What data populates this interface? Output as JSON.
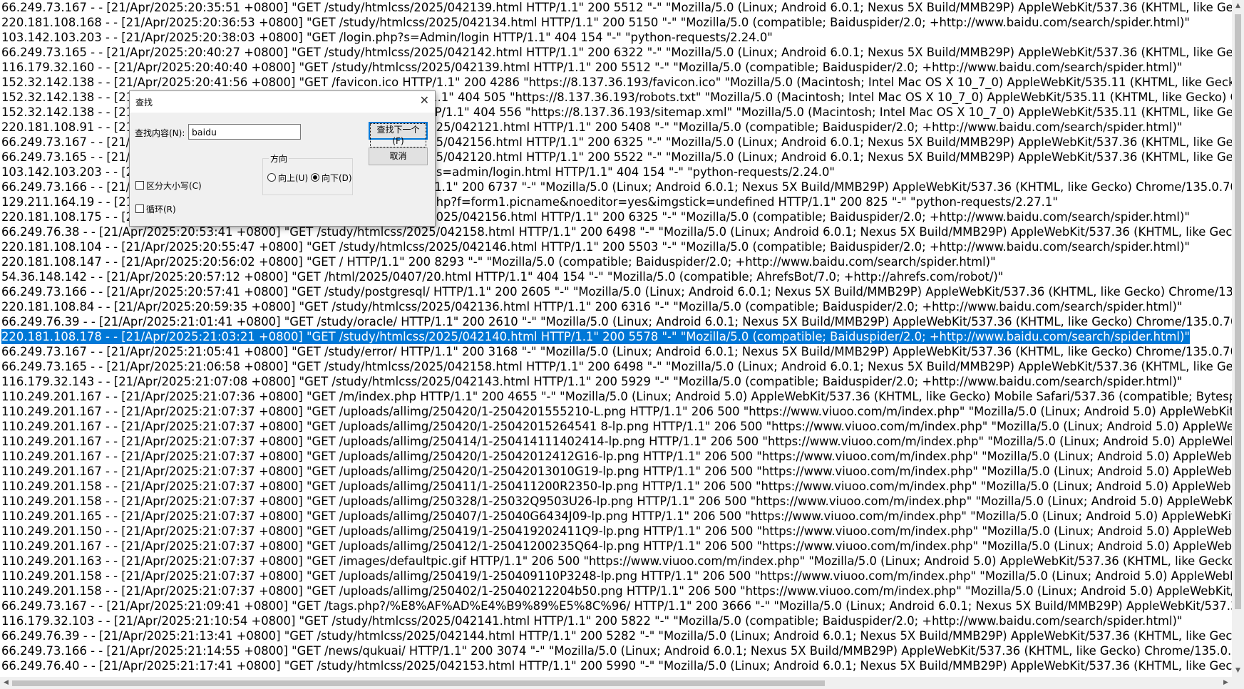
{
  "log_lines": [
    "66.249.73.167 - - [21/Apr/2025:20:35:51 +0800] \"GET /study/htmlcss/2025/042139.html HTTP/1.1\" 200 5512 \"-\" \"Mozilla/5.0 (Linux; Android 6.0.1; Nexus 5X Build/MMB29P) AppleWebKit/537.36 (KHTML, like Gecko) Chrome/135.0",
    "220.181.108.168 - - [21/Apr/2025:20:36:53 +0800] \"GET /study/htmlcss/2025/042134.html HTTP/1.1\" 200 5150 \"-\" \"Mozilla/5.0 (compatible; Baiduspider/2.0; +http://www.baidu.com/search/spider.html)\"",
    "103.142.103.203 - - [21/Apr/2025:20:38:03 +0800] \"GET /login.php?s=Admin/login HTTP/1.1\" 404 154 \"-\" \"python-requests/2.24.0\"",
    "66.249.73.165 - - [21/Apr/2025:20:40:27 +0800] \"GET /study/htmlcss/2025/042142.html HTTP/1.1\" 200 6322 \"-\" \"Mozilla/5.0 (Linux; Android 6.0.1; Nexus 5X Build/MMB29P) AppleWebKit/537.36 (KHTML, like Gecko) Chrome/135.0",
    "116.179.32.160 - - [21/Apr/2025:20:40:40 +0800] \"GET /study/htmlcss/2025/042139.html HTTP/1.1\" 200 5512 \"-\" \"Mozilla/5.0 (compatible; Baiduspider/2.0; +http://www.baidu.com/search/spider.html)\"",
    "152.32.142.138 - - [21/Apr/2025:20:41:56 +0800] \"GET /favicon.ico HTTP/1.1\" 200 4286 \"https://8.137.36.193/favicon.ico\" \"Mozilla/5.0 (Macintosh; Intel Mac OS X 10_7_0) AppleWebKit/535.11 (KHTML, like Gecko) Chrome/17.0.96",
    "152.32.142.138 - - [21/Apr/2025:20:41:56 +0800] \"GET /robots.txt HTTP/1.1\" 404 505 \"https://8.137.36.193/robots.txt\" \"Mozilla/5.0 (Macintosh; Intel Mac OS X 10_7_0) AppleWebKit/535.11 (KHTML, like Gecko) Chrome/17.0.963.56",
    "152.32.142.138 - - [21/Apr/2025:20:41:57 +0800] \"GET /sitemap.xml HTTP/1.1\" 404 556 \"https://8.137.36.193/sitemap.xml\" \"Mozilla/5.0 (Macintosh; Intel Mac OS X 10_7_0) AppleWebKit/535.11 (KHTML, like Gecko) Chrome/17.0.9",
    "220.181.108.91 - - [21/Apr/2025:20:43:06 +0800] \"GET /study/htmlcss/2025/042121.html HTTP/1.1\" 200 5408 \"-\" \"Mozilla/5.0 (compatible; Baiduspider/2.0; +http://www.baidu.com/search/spider.html)\"",
    "66.249.73.167 - - [21/Apr/2025:20:45:12 +0800] \"GET /study/htmlcss/2025/042156.html HTTP/1.1\" 200 6325 \"-\" \"Mozilla/5.0 (Linux; Android 6.0.1; Nexus 5X Build/MMB29P) AppleWebKit/537.36 (KHTML, like Gecko) Chrome/135.0",
    "66.249.73.165 - - [21/Apr/2025:20:46:30 +0800] \"GET /study/htmlcss/2025/042120.html HTTP/1.1\" 200 5522 \"-\" \"Mozilla/5.0 (Linux; Android 6.0.1; Nexus 5X Build/MMB29P) AppleWebKit/537.36 (KHTML, like Gecko) Chrome/135.0",
    "103.142.103.203 - - [21/Apr/2025:20:47:18 +0800] \"GET /login/login.php?s=admin/login.html HTTP/1.1\" 404 154 \"-\" \"python-requests/2.24.0\"",
    "66.249.73.166 - - [21/Apr/2025:20:48:02 +0800] \"GET /study/linux/ HTTP/1.1\" 200 6737 \"-\" \"Mozilla/5.0 (Linux; Android 6.0.1; Nexus 5X Build/MMB29P) AppleWebKit/537.36 (KHTML, like Gecko) Chrome/135.0.7049.95 Mobile S",
    "129.211.164.19 - - [21/Apr/2025:20:49:33 +0800] \"GET /tags.php?/ages.php?f=form1.picname&noeditor=yes&imgstick=undefined HTTP/1.1\" 200 825 \"-\" \"python-requests/2.27.1\"",
    "220.181.108.175 - - [21/Apr/2025:20:51:10 +0800] \"GET /study/htmlcss/2025/042156.html HTTP/1.1\" 200 6325 \"-\" \"Mozilla/5.0 (compatible; Baiduspider/2.0; +http://www.baidu.com/search/spider.html)\"",
    "66.249.76.38 - - [21/Apr/2025:20:53:41 +0800] \"GET /study/htmlcss/2025/042158.html HTTP/1.1\" 200 6498 \"-\" \"Mozilla/5.0 (Linux; Android 6.0.1; Nexus 5X Build/MMB29P) AppleWebKit/537.36 (KHTML, like Gecko) Chrome/135.0.",
    "220.181.108.104 - - [21/Apr/2025:20:55:47 +0800] \"GET /study/htmlcss/2025/042146.html HTTP/1.1\" 200 5503 \"-\" \"Mozilla/5.0 (compatible; Baiduspider/2.0; +http://www.baidu.com/search/spider.html)\"",
    "220.181.108.147 - - [21/Apr/2025:20:56:02 +0800] \"GET / HTTP/1.1\" 200 8293 \"-\" \"Mozilla/5.0 (compatible; Baiduspider/2.0; +http://www.baidu.com/search/spider.html)\"",
    "54.36.148.142 - - [21/Apr/2025:20:57:12 +0800] \"GET /html/2025/0407/20.html HTTP/1.1\" 404 154 \"-\" \"Mozilla/5.0 (compatible; AhrefsBot/7.0; +http://ahrefs.com/robot/)\"",
    "66.249.73.166 - - [21/Apr/2025:20:57:41 +0800] \"GET /study/postgresql/ HTTP/1.1\" 200 2605 \"-\" \"Mozilla/5.0 (Linux; Android 6.0.1; Nexus 5X Build/MMB29P) AppleWebKit/537.36 (KHTML, like Gecko) Chrome/135.0.7049.95 Mobile Sa",
    "220.181.108.84 - - [21/Apr/2025:20:59:35 +0800] \"GET /study/htmlcss/2025/042136.html HTTP/1.1\" 200 6316 \"-\" \"Mozilla/5.0 (compatible; Baiduspider/2.0; +http://www.baidu.com/search/spider.html)\"",
    "66.249.76.39 - - [21/Apr/2025:21:01:41 +0800] \"GET /study/oracle/ HTTP/1.1\" 200 2610 \"-\" \"Mozilla/5.0 (Linux; Android 6.0.1; Nexus 5X Build/MMB29P) AppleWebKit/537.36 (KHTML, like Gecko) Chrome/135.0.7049.95 Mobile Safa",
    "220.181.108.178 - - [21/Apr/2025:21:03:21 +0800] \"GET /study/htmlcss/2025/042140.html HTTP/1.1\" 200 5578 \"-\" \"Mozilla/5.0 (compatible; Baiduspider/2.0; +http://www.baidu.com/search/spider.html)\"",
    "66.249.73.167 - - [21/Apr/2025:21:05:41 +0800] \"GET /study/error/ HTTP/1.1\" 200 3168 \"-\" \"Mozilla/5.0 (Linux; Android 6.0.1; Nexus 5X Build/MMB29P) AppleWebKit/537.36 (KHTML, like Gecko) Chrome/135.0.7049.95 Mobile Safa",
    "66.249.73.165 - - [21/Apr/2025:21:06:58 +0800] \"GET /study/htmlcss/2025/042158.html HTTP/1.1\" 200 6498 \"-\" \"Mozilla/5.0 (Linux; Android 6.0.1; Nexus 5X Build/MMB29P) AppleWebKit/537.36 (KHTML, like Gecko) Chrome/135.0",
    "116.179.32.143 - - [21/Apr/2025:21:07:08 +0800] \"GET /study/htmlcss/2025/042143.html HTTP/1.1\" 200 5929 \"-\" \"Mozilla/5.0 (compatible; Baiduspider/2.0; +http://www.baidu.com/search/spider.html)\"",
    "110.249.201.167 - - [21/Apr/2025:21:07:36 +0800] \"GET /m/index.php HTTP/1.1\" 200 4655 \"-\" \"Mozilla/5.0 (Linux; Android 5.0) AppleWebKit/537.36 (KHTML, like Gecko) Mobile Safari/537.36 (compatible; Bytespider; https://zhanz",
    "110.249.201.167 - - [21/Apr/2025:21:07:37 +0800] \"GET /uploads/allimg/250420/1-2504201555210-L.png HTTP/1.1\" 206 500 \"https://www.viuoo.com/m/index.php\" \"Mozilla/5.0 (Linux; Android 5.0) AppleWebKit/537.36 (KHTML, l",
    "110.249.201.167 - - [21/Apr/2025:21:07:37 +0800] \"GET /uploads/allimg/250420/1-25042015264541 8-lp.png HTTP/1.1\" 206 500 \"https://www.viuoo.com/m/index.php\" \"Mozilla/5.0 (Linux; Android 5.0) AppleWebKit/537.36 (KHTM",
    "110.249.201.167 - - [21/Apr/2025:21:07:37 +0800] \"GET /uploads/allimg/250414/1-250414111402414-lp.png HTTP/1.1\" 206 500 \"https://www.viuoo.com/m/index.php\" \"Mozilla/5.0 (Linux; Android 5.0) AppleWebKit/537.36 (KHTM",
    "110.249.201.167 - - [21/Apr/2025:21:07:37 +0800] \"GET /uploads/allimg/250420/1-25042012412G16-lp.png HTTP/1.1\" 206 500 \"https://www.viuoo.com/m/index.php\" \"Mozilla/5.0 (Linux; Android 5.0) AppleWebKit/537.36 (KHTMI",
    "110.249.201.167 - - [21/Apr/2025:21:07:37 +0800] \"GET /uploads/allimg/250420/1-25042013010G19-lp.png HTTP/1.1\" 206 500 \"https://www.viuoo.com/m/index.php\" \"Mozilla/5.0 (Linux; Android 5.0) AppleWebKit/537.36 (KHTMI",
    "110.249.201.158 - - [21/Apr/2025:21:07:37 +0800] \"GET /uploads/allimg/250411/1-250411200R2350-lp.png HTTP/1.1\" 206 500 \"https://www.viuoo.com/m/index.php\" \"Mozilla/5.0 (Linux; Android 5.0) AppleWebKit/537.36 (KHTMI",
    "110.249.201.158 - - [21/Apr/2025:21:07:37 +0800] \"GET /uploads/allimg/250328/1-25032Q9503U26-lp.png HTTP/1.1\" 206 500 \"https://www.viuoo.com/m/index.php\" \"Mozilla/5.0 (Linux; Android 5.0) AppleWebKit/537.36 (KHTML",
    "110.249.201.165 - - [21/Apr/2025:21:07:37 +0800] \"GET /uploads/allimg/250407/1-25040G6434J09-lp.png HTTP/1.1\" 206 500 \"https://www.viuoo.com/m/index.php\" \"Mozilla/5.0 (Linux; Android 5.0) AppleWebKit/537.36 (KHTML,",
    "110.249.201.150 - - [21/Apr/2025:21:07:37 +0800] \"GET /uploads/allimg/250419/1-250419202411Q9-lp.png HTTP/1.1\" 206 500 \"https://www.viuoo.com/m/index.php\" \"Mozilla/5.0 (Linux; Android 5.0) AppleWebKit/537.36 (KHTMI",
    "110.249.201.167 - - [21/Apr/2025:21:07:37 +0800] \"GET /uploads/allimg/250412/1-25041200235Q64-lp.png HTTP/1.1\" 206 500 \"https://www.viuoo.com/m/index.php\" \"Mozilla/5.0 (Linux; Android 5.0) AppleWebKit/537.36 (KHTMI",
    "110.249.201.163 - - [21/Apr/2025:21:07:37 +0800] \"GET /images/defaultpic.gif HTTP/1.1\" 206 500 \"https://www.viuoo.com/m/index.php\" \"Mozilla/5.0 (Linux; Android 5.0) AppleWebKit/537.36 (KHTML, like Gecko) Mobile Safari/5",
    "110.249.201.158 - - [21/Apr/2025:21:07:37 +0800] \"GET /uploads/allimg/250419/1-250409110P3248-lp.png HTTP/1.1\" 206 500 \"https://www.viuoo.com/m/index.php\" \"Mozilla/5.0 (Linux; Android 5.0) AppleWebKit/537.36 (KHTM",
    "110.249.201.158 - - [21/Apr/2025:21:07:37 +0800] \"GET /uploads/allimg/250402/1-25040212204b50.png HTTP/1.1\" 206 500 \"https://www.viuoo.com/m/index.php\" \"Mozilla/5.0 (Linux; Android 5.0) AppleWebKit/537.36 (KHTML, li",
    "66.249.73.167 - - [21/Apr/2025:21:09:41 +0800] \"GET /tags.php?/%E8%AF%AD%E4%B9%89%E5%8C%96/ HTTP/1.1\" 200 3666 \"-\" \"Mozilla/5.0 (Linux; Android 6.0.1; Nexus 5X Build/MMB29P) AppleWebKit/537.36 (KHTML, like Ge",
    "116.179.32.103 - - [21/Apr/2025:21:10:54 +0800] \"GET /study/htmlcss/2025/042141.html HTTP/1.1\" 200 5822 \"-\" \"Mozilla/5.0 (compatible; Baiduspider/2.0; +http://www.baidu.com/search/spider.html)\"",
    "66.249.76.39 - - [21/Apr/2025:21:13:41 +0800] \"GET /study/htmlcss/2025/042144.html HTTP/1.1\" 200 5282 \"-\" \"Mozilla/5.0 (Linux; Android 6.0.1; Nexus 5X Build/MMB29P) AppleWebKit/537.36 (KHTML, like Gecko) Chrome/135.0.",
    "66.249.73.166 - - [21/Apr/2025:21:14:55 +0800] \"GET /news/qukuai/ HTTP/1.1\" 200 3074 \"-\" \"Mozilla/5.0 (Linux; Android 6.0.1; Nexus 5X Build/MMB29P) AppleWebKit/537.36 (KHTML, like Gecko) Chrome/135.0.7049.95 Mobile Sa",
    "66.249.76.40 - - [21/Apr/2025:21:17:41 +0800] \"GET /study/htmlcss/2025/042153.html HTTP/1.1\" 200 5990 \"-\" \"Mozilla/5.0 (Linux; Android 6.0.1; Nexus 5X Build/MMB29P) AppleWebKit/537.36 (KHTML, like Gecko) Chrome/135.0."
  ],
  "selected_line_index": 22,
  "selection_color": "#0078d7",
  "find_dialog": {
    "title": "查找",
    "find_label": "查找内容(N):",
    "find_value": "baidu",
    "find_next_label": "查找下一个(F)",
    "cancel_label": "取消",
    "direction_label": "方向",
    "up_label": "向上(U)",
    "down_label": "向下(D)",
    "direction_selected": "down",
    "match_case_label": "区分大小写(C)",
    "wrap_label": "循环(R)",
    "close_icon": "close-icon"
  },
  "scrollbar_icons": {
    "up": "chevron-up-icon",
    "down": "chevron-down-icon",
    "left": "chevron-left-icon",
    "right": "chevron-right-icon"
  }
}
